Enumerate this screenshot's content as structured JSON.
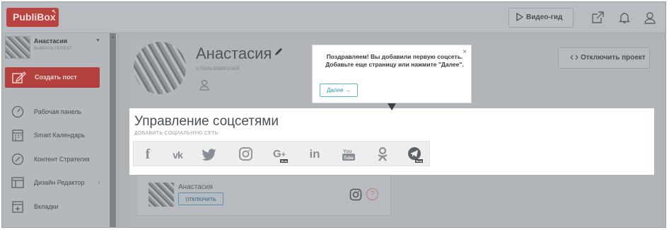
{
  "app": {
    "logo": "PubliBox",
    "logo_mark": "↖"
  },
  "topbar": {
    "guide_label": "Видео-гид"
  },
  "sidebar": {
    "project_name": "Анастасия",
    "project_sub": "ВЫБРАТЬ ПРОЕКТ",
    "create_post": "Создать пост",
    "items": [
      {
        "label": "Рабочая панель",
        "icon": "dashboard-icon"
      },
      {
        "label": "Smart Календарь",
        "icon": "calendar-icon"
      },
      {
        "label": "Контент Стратегия",
        "icon": "compass-icon"
      },
      {
        "label": "Дизайн Редактор",
        "icon": "layout-icon"
      },
      {
        "label": "Вкладки",
        "icon": "tabs-icon"
      }
    ]
  },
  "project": {
    "title": "Анастасия",
    "users": "0 ПОЛЬЗОВАТЕЛЕЙ",
    "disconnect_project": "Отключить проект"
  },
  "social": {
    "title": "Управление соцсетями",
    "subtitle": "ДОБАВИТЬ СОЦИАЛЬНУЮ СЕТЬ",
    "networks": [
      {
        "name": "facebook",
        "glyph": "f"
      },
      {
        "name": "vk",
        "glyph": "vk"
      },
      {
        "name": "twitter",
        "glyph": ""
      },
      {
        "name": "instagram",
        "glyph": ""
      },
      {
        "name": "google-plus",
        "glyph": "G+",
        "badge": "Beta"
      },
      {
        "name": "linkedin",
        "glyph": "in"
      },
      {
        "name": "youtube",
        "glyph": "You"
      },
      {
        "name": "odnoklassniki",
        "glyph": ""
      },
      {
        "name": "telegram",
        "glyph": "",
        "badge": "Beta"
      }
    ]
  },
  "tooltip": {
    "text": "Поздравляем! Вы добавили первую соцсеть. Добавьте еще страницу или нажмите \"Далее\".",
    "close": "×",
    "next_label": "Далее →"
  },
  "account": {
    "name": "Анастасия",
    "disconnect": "отключить",
    "help": "?"
  }
}
